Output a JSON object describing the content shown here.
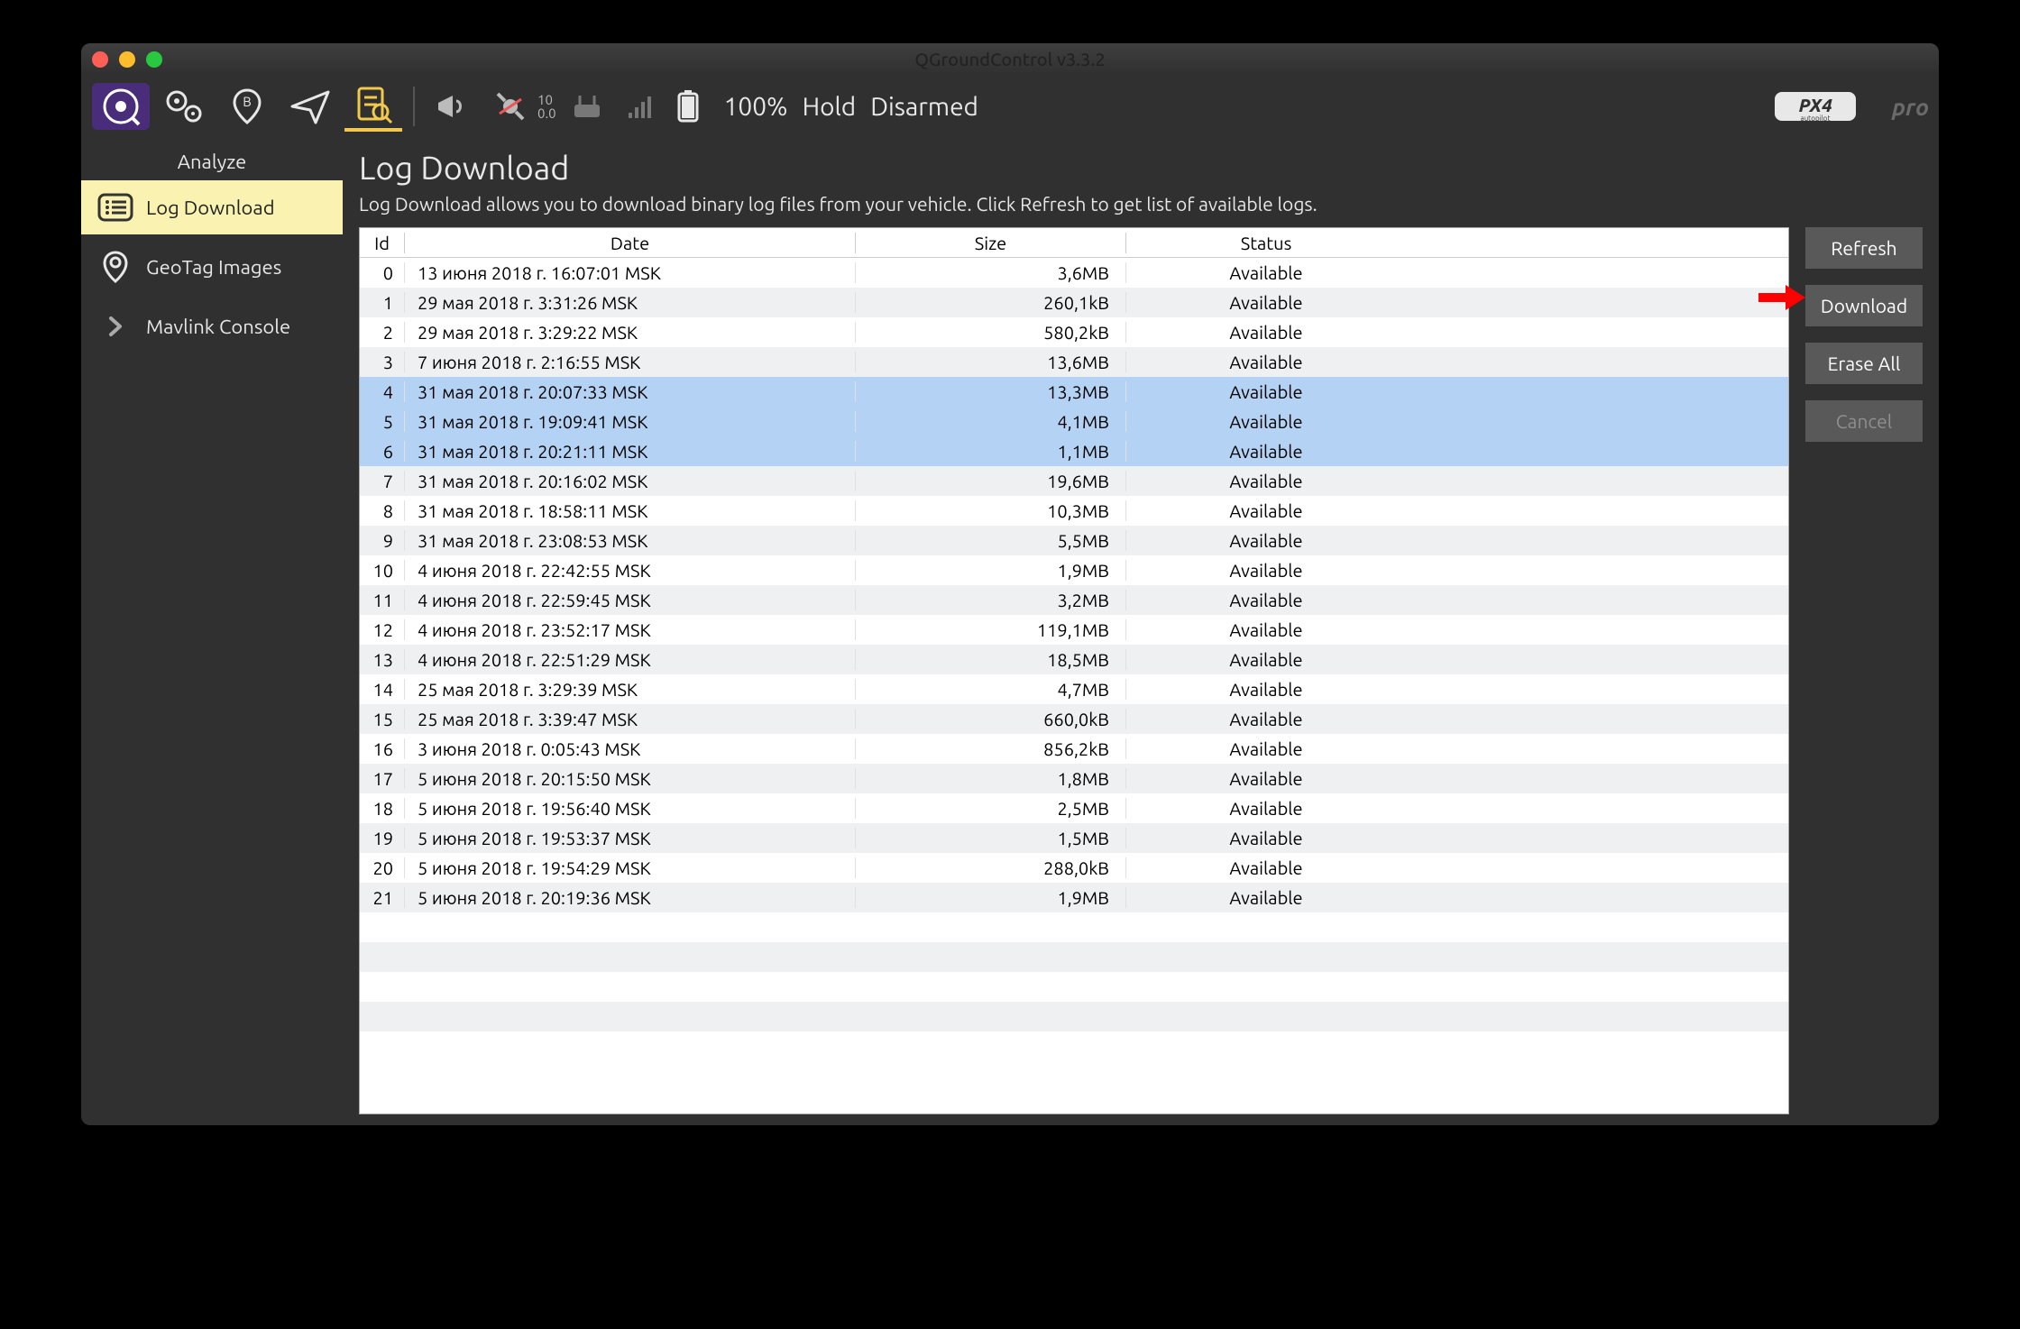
{
  "window": {
    "title": "QGroundControl v3.3.2"
  },
  "toolbar": {
    "counter_top": "10",
    "counter_bot": "0.0",
    "battery": "100%",
    "mode": "Hold",
    "armed": "Disarmed"
  },
  "sidebar": {
    "title": "Analyze",
    "items": [
      {
        "label": "Log Download",
        "active": true
      },
      {
        "label": "GeoTag Images",
        "active": false
      },
      {
        "label": "Mavlink Console",
        "active": false
      }
    ]
  },
  "page": {
    "title": "Log Download",
    "description": "Log Download allows you to download binary log files from your vehicle. Click Refresh to get list of available logs."
  },
  "buttons": {
    "refresh": "Refresh",
    "download": "Download",
    "erase": "Erase All",
    "cancel": "Cancel"
  },
  "table": {
    "headers": {
      "id": "Id",
      "date": "Date",
      "size": "Size",
      "status": "Status"
    },
    "selected_ids": [
      4,
      5,
      6
    ],
    "rows": [
      {
        "id": 0,
        "date": "13 июня 2018 г. 16:07:01 MSK",
        "size": "3,6MB",
        "status": "Available"
      },
      {
        "id": 1,
        "date": "29 мая 2018 г. 3:31:26 MSK",
        "size": "260,1kB",
        "status": "Available"
      },
      {
        "id": 2,
        "date": "29 мая 2018 г. 3:29:22 MSK",
        "size": "580,2kB",
        "status": "Available"
      },
      {
        "id": 3,
        "date": "7 июня 2018 г. 2:16:55 MSK",
        "size": "13,6MB",
        "status": "Available"
      },
      {
        "id": 4,
        "date": "31 мая 2018 г. 20:07:33 MSK",
        "size": "13,3MB",
        "status": "Available"
      },
      {
        "id": 5,
        "date": "31 мая 2018 г. 19:09:41 MSK",
        "size": "4,1MB",
        "status": "Available"
      },
      {
        "id": 6,
        "date": "31 мая 2018 г. 20:21:11 MSK",
        "size": "1,1MB",
        "status": "Available"
      },
      {
        "id": 7,
        "date": "31 мая 2018 г. 20:16:02 MSK",
        "size": "19,6MB",
        "status": "Available"
      },
      {
        "id": 8,
        "date": "31 мая 2018 г. 18:58:11 MSK",
        "size": "10,3MB",
        "status": "Available"
      },
      {
        "id": 9,
        "date": "31 мая 2018 г. 23:08:53 MSK",
        "size": "5,5MB",
        "status": "Available"
      },
      {
        "id": 10,
        "date": "4 июня 2018 г. 22:42:55 MSK",
        "size": "1,9MB",
        "status": "Available"
      },
      {
        "id": 11,
        "date": "4 июня 2018 г. 22:59:45 MSK",
        "size": "3,2MB",
        "status": "Available"
      },
      {
        "id": 12,
        "date": "4 июня 2018 г. 23:52:17 MSK",
        "size": "119,1MB",
        "status": "Available"
      },
      {
        "id": 13,
        "date": "4 июня 2018 г. 22:51:29 MSK",
        "size": "18,5MB",
        "status": "Available"
      },
      {
        "id": 14,
        "date": "25 мая 2018 г. 3:29:39 MSK",
        "size": "4,7MB",
        "status": "Available"
      },
      {
        "id": 15,
        "date": "25 мая 2018 г. 3:39:47 MSK",
        "size": "660,0kB",
        "status": "Available"
      },
      {
        "id": 16,
        "date": "3 июня 2018 г. 0:05:43 MSK",
        "size": "856,2kB",
        "status": "Available"
      },
      {
        "id": 17,
        "date": "5 июня 2018 г. 20:15:50 MSK",
        "size": "1,8MB",
        "status": "Available"
      },
      {
        "id": 18,
        "date": "5 июня 2018 г. 19:56:40 MSK",
        "size": "2,5MB",
        "status": "Available"
      },
      {
        "id": 19,
        "date": "5 июня 2018 г. 19:53:37 MSK",
        "size": "1,5MB",
        "status": "Available"
      },
      {
        "id": 20,
        "date": "5 июня 2018 г. 19:54:29 MSK",
        "size": "288,0kB",
        "status": "Available"
      },
      {
        "id": 21,
        "date": "5 июня 2018 г. 20:19:36 MSK",
        "size": "1,9MB",
        "status": "Available"
      }
    ]
  }
}
